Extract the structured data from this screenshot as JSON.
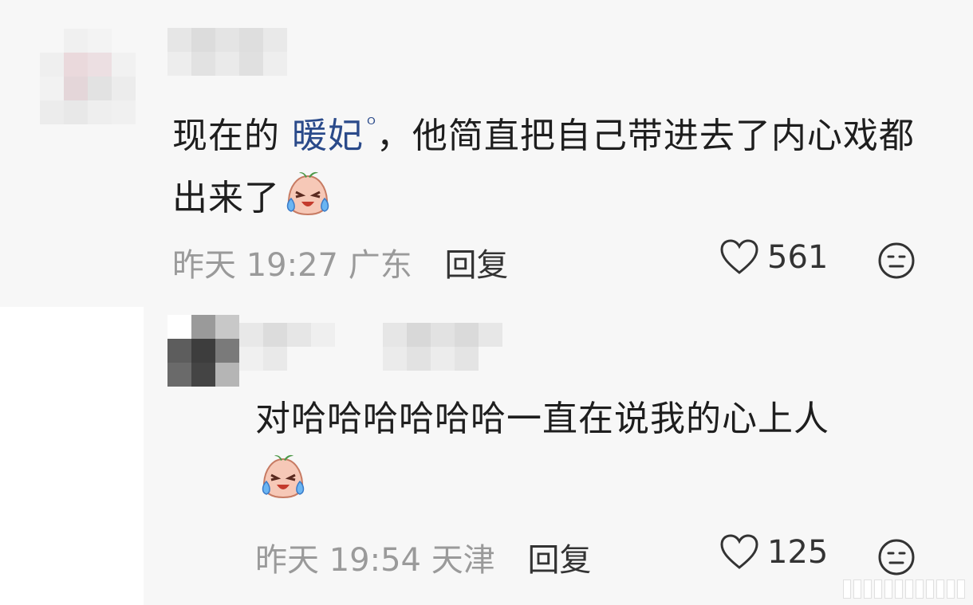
{
  "comments": [
    {
      "text_before": "现在的 ",
      "mention": "暖妃",
      "mention_icon": "search-icon",
      "text_after": "，他简直把自己带进去了内心戏都出来了",
      "time": "昨天 19:27",
      "location": "广东",
      "reply_label": "回复",
      "likes": "561"
    },
    {
      "text": "对哈哈哈哈哈哈一直在说我的心上人",
      "time": "昨天 19:54",
      "location": "天津",
      "reply_label": "回复",
      "likes": "125"
    }
  ],
  "colors": {
    "background": "#f7f7f7",
    "mention": "#2a4a8a",
    "meta": "#9a9a9a"
  }
}
